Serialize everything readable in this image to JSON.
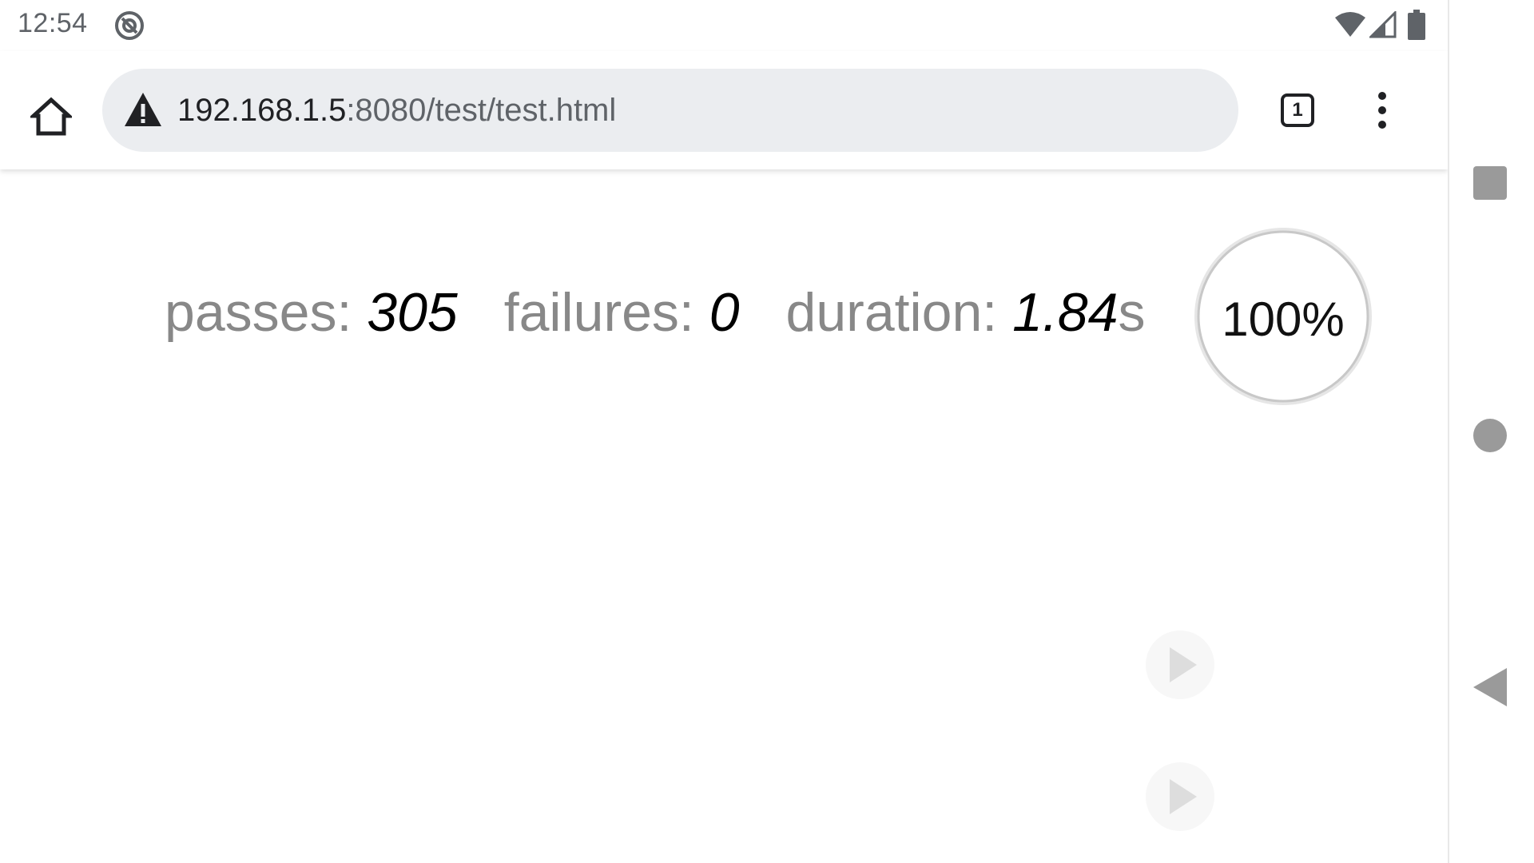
{
  "status_bar": {
    "time": "12:54",
    "icons": [
      "sync-icon",
      "wifi-icon",
      "cell-signal-icon",
      "battery-icon"
    ]
  },
  "browser": {
    "url_host": "192.168.1.5",
    "url_path": ":8080/test/test.html",
    "tab_count": "1",
    "icons": [
      "home-icon",
      "warning-icon",
      "tabs-icon",
      "more-vert-icon"
    ]
  },
  "report": {
    "passes_label": "passes: ",
    "passes_value": "305",
    "failures_label": "failures: ",
    "failures_value": "0",
    "duration_label": "duration: ",
    "duration_value": "1.84",
    "duration_unit": "s",
    "progress_text": "100%",
    "progress_fraction": 1.0
  },
  "colors": {
    "label_gray": "#888888",
    "value_black": "#000000",
    "omnibox_bg": "#ebedf0",
    "nav_gray": "#9a9a9a",
    "ring_gray": "#cccccc"
  },
  "nav_bar": {
    "icons": [
      "recents-icon",
      "home-icon",
      "back-icon"
    ]
  }
}
